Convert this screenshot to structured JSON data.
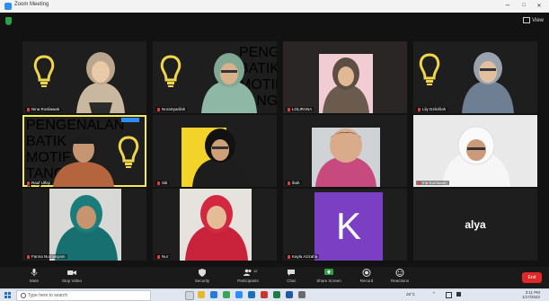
{
  "window": {
    "title": "Zoom Meeting",
    "minimize": "–",
    "maximize": "□",
    "close": "✕"
  },
  "top": {
    "view_label": "View"
  },
  "slide_text": "PENGENALAN BATIK MOTIF\nTANGAN\n17 JAN 2022\n\nMENINGKATKAN\nDAN KETERAMPILAN\nMELALUI MOTIF",
  "participants": [
    {
      "name": "Nina Rosliawati",
      "muted": true
    },
    {
      "name": "NoraSyarifah",
      "muted": true
    },
    {
      "name": "LOLIRANA",
      "muted": true
    },
    {
      "name": "Lily Dzikrillah",
      "muted": true
    },
    {
      "name": "Rauf Ulfaji",
      "muted": true
    },
    {
      "name": "Siti",
      "muted": true
    },
    {
      "name": "ibah",
      "muted": true
    },
    {
      "name": "Ina Kurniasari",
      "muted": true
    },
    {
      "name": "Fanna Nurmaryam",
      "muted": true
    },
    {
      "name": "Nur",
      "muted": true
    },
    {
      "name": "Kayla Azizaha",
      "muted": true,
      "avatar_letter": "K",
      "avatar_color": "#7b3fc4"
    },
    {
      "name": "alya",
      "muted": true,
      "display_text": "alya"
    }
  ],
  "toolbar": {
    "mute": "Mute",
    "stop_video": "Stop Video",
    "security": "Security",
    "participants": "Participants",
    "participants_count": "12",
    "chat": "Chat",
    "share_screen": "Share Screen",
    "record": "Record",
    "reactions": "Reactions",
    "end": "End",
    "share_color": "#2ea043",
    "end_color": "#e02828"
  },
  "taskbar": {
    "search_placeholder": "Type here to search",
    "weather": "26°C",
    "time": "3:11 PM",
    "date": "1/17/2022"
  }
}
